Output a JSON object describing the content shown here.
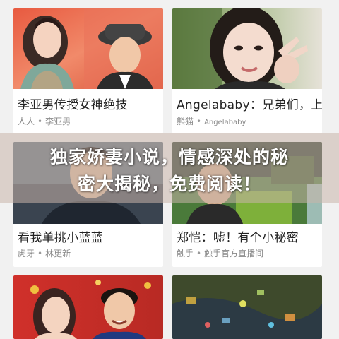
{
  "cards": [
    {
      "title": "李亚男传授女神绝技",
      "author": "人人",
      "source": "李亚男"
    },
    {
      "title": "Angelababy：兄弟们，上",
      "author": "熊猫",
      "source": "Angelababy"
    },
    {
      "title": "看我单挑小蓝蓝",
      "author": "虎牙",
      "source": "林更新"
    },
    {
      "title": "郑恺：嘘！有个小秘密",
      "author": "触手",
      "source": "触手官方直播间"
    }
  ],
  "overlay": {
    "line1": "独家娇妻小说，情感深处的秘",
    "line2": "密大揭秘，免费阅读！"
  },
  "colors": {
    "background": "#f1f1f1",
    "card": "#ffffff",
    "title_text": "#222222",
    "meta_text": "#888888"
  }
}
